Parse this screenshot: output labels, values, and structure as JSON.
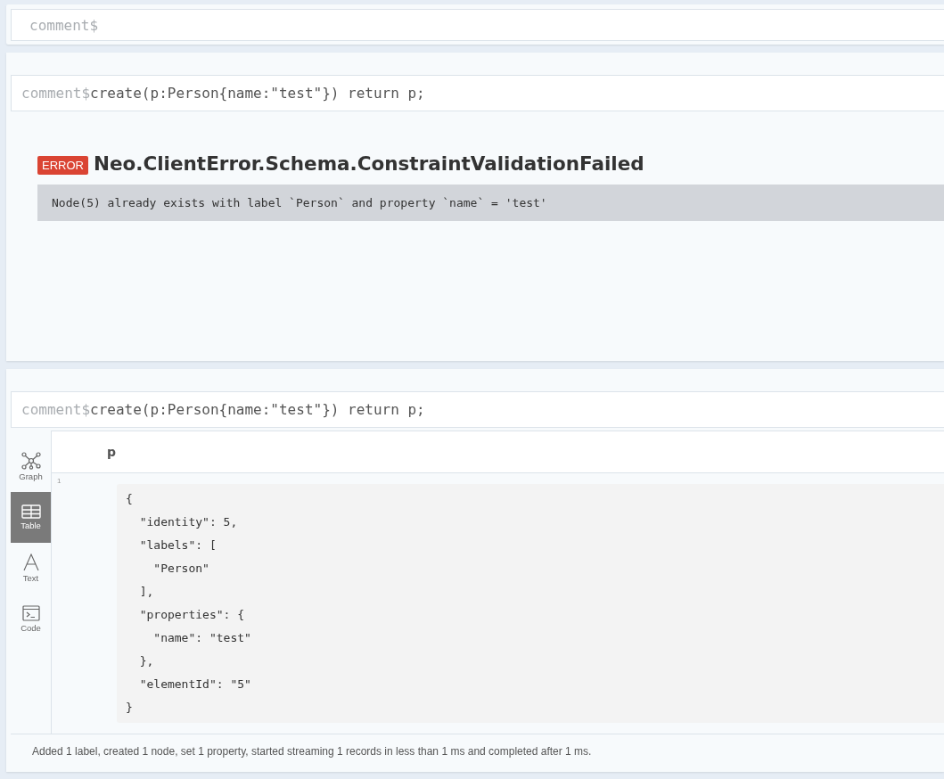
{
  "editor": {
    "prompt": "comment$"
  },
  "frames": [
    {
      "kind": "error",
      "prompt": "comment$",
      "query": "create(p:Person{name:\"test\"}) return p;",
      "badge": "ERROR",
      "title": "Neo.ClientError.Schema.ConstraintValidationFailed",
      "message": "Node(5) already exists with label `Person` and property `name` = 'test'"
    },
    {
      "kind": "table",
      "prompt": "comment$",
      "query": "create(p:Person{name:\"test\"}) return p;",
      "tabs": [
        {
          "kind": "graph",
          "label": "Graph",
          "selected": false
        },
        {
          "kind": "table",
          "label": "Table",
          "selected": true
        },
        {
          "kind": "text",
          "label": "Text",
          "selected": false
        },
        {
          "kind": "code",
          "label": "Code",
          "selected": false
        }
      ],
      "column": "p",
      "row_number": "1",
      "cell": "{\n  \"identity\": 5,\n  \"labels\": [\n    \"Person\"\n  ],\n  \"properties\": {\n    \"name\": \"test\"\n  },\n  \"elementId\": \"5\"\n}",
      "status": "Added 1 label, created 1 node, set 1 property, started streaming 1 records in less than 1 ms and completed after 1 ms."
    }
  ]
}
